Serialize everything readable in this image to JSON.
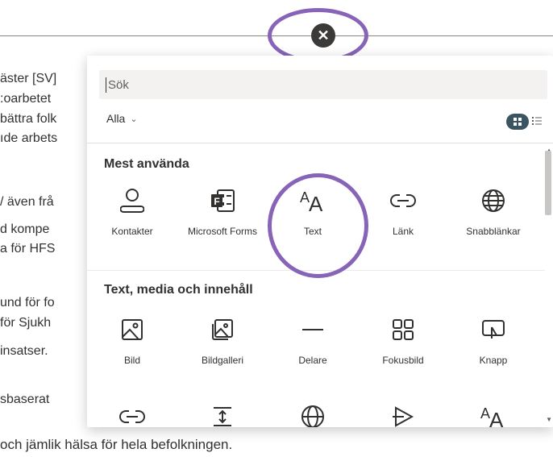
{
  "background_text": {
    "lines": [
      "äster [SV]",
      ":oarbetet",
      "bättra folk",
      "ıde arbets",
      "/ även frå",
      "d kompe",
      "a för HFS",
      "und för fo",
      "för Sjukh",
      " insatser.",
      "sbaserat"
    ],
    "bottom_line": "och jämlik hälsa för hela befolkningen."
  },
  "close_button": {
    "symbol": "✕"
  },
  "toolbox": {
    "search_placeholder": "Sök",
    "filter_label": "Alla",
    "sections": [
      {
        "title": "Mest använda",
        "items": [
          {
            "label": "Kontakter",
            "icon": "person-icon"
          },
          {
            "label": "Microsoft Forms",
            "icon": "forms-icon"
          },
          {
            "label": "Text",
            "icon": "text-icon"
          },
          {
            "label": "Länk",
            "icon": "link-icon"
          },
          {
            "label": "Snabblänkar",
            "icon": "globe-icon"
          }
        ]
      },
      {
        "title": "Text, media och innehåll",
        "items": [
          {
            "label": "Bild",
            "icon": "image-icon"
          },
          {
            "label": "Bildgalleri",
            "icon": "image-gallery-icon"
          },
          {
            "label": "Delare",
            "icon": "divider-icon"
          },
          {
            "label": "Fokusbild",
            "icon": "hero-icon"
          },
          {
            "label": "Knapp",
            "icon": "button-icon"
          }
        ],
        "partial_row_icons": [
          "link-icon",
          "spacer-icon",
          "globe-icon",
          "embed-icon",
          "text-icon"
        ]
      }
    ]
  },
  "colors": {
    "highlight_ring": "#8764b8",
    "toggle_active": "#3b5462",
    "close_button_bg": "#3b3a39"
  }
}
